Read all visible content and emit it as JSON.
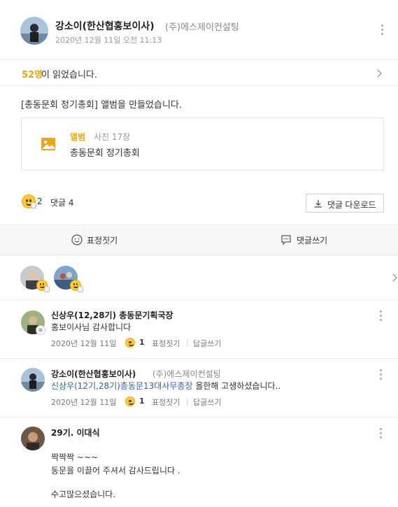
{
  "post": {
    "author_name": "강소이(한산협홍보이사)",
    "author_company": "(주)에스제이컨설팅",
    "date": "2020년 12월 11일 오전 11:13",
    "readers_count": "52명",
    "readers_text": "이 읽었습니다.",
    "body": "[총동문회 정기총회] 앨범을 만들었습니다.",
    "album": {
      "type_label": "앨범",
      "photo_count": "사진 17장",
      "title": "총동문회 정기총회"
    },
    "reaction_count": "2",
    "comment_count": "댓글 4",
    "download_label": "댓글 다운로드"
  },
  "actions": {
    "react_label": "표정짓기",
    "comment_label": "댓글쓰기"
  },
  "comments": [
    {
      "author": "신상우(12,28기) 총동문기획국장",
      "company": "",
      "mention": "",
      "text": "홍보이사님 감사합니다",
      "date": "2020년 12월 11일",
      "reaction_count": "1",
      "react_label": "표정짓기",
      "reply_label": "답글쓰기"
    },
    {
      "author": "강소이(한산협홍보이사)",
      "company": "(주)에스제이컨설팅",
      "mention": "신상우(12기,28기)총동문13대사무총장",
      "text": " 올한해 고생하셨습니다..",
      "date": "2020년 12월 11일",
      "reaction_count": "1",
      "react_label": "표정짓기",
      "reply_label": "답글쓰기"
    },
    {
      "author": "29기. 이대식",
      "company": "",
      "mention": "",
      "lines": [
        "짝짝짝 ~~~",
        "동문을 이끌어 주셔서 감사드립니다 .",
        "수고많으셨습니다."
      ]
    }
  ],
  "colors": {
    "accent": "#f1a413",
    "mention": "#3560a8",
    "muted": "#999999"
  }
}
